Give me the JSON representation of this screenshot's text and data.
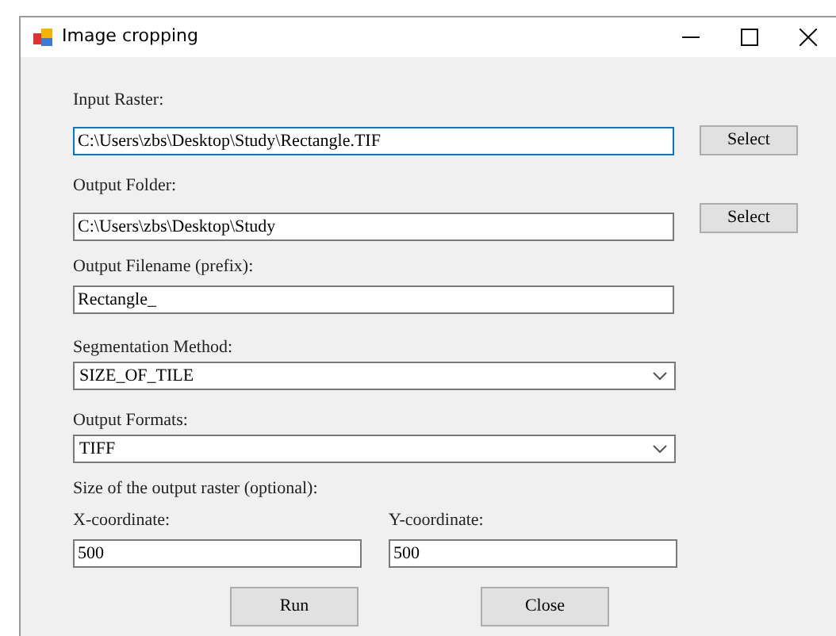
{
  "window": {
    "title": "Image cropping"
  },
  "input_raster": {
    "label": "Input Raster:",
    "value": "C:\\Users\\zbs\\Desktop\\Study\\Rectangle.TIF",
    "focused": true,
    "button": "Select"
  },
  "output_folder": {
    "label": "Output Folder:",
    "value": "C:\\Users\\zbs\\Desktop\\Study",
    "focused": false,
    "button": "Select"
  },
  "output_filename": {
    "label": "Output Filename (prefix):",
    "value": "Rectangle_"
  },
  "segmentation_method": {
    "label": "Segmentation Method:",
    "value": "SIZE_OF_TILE"
  },
  "output_formats": {
    "label": "Output Formats:",
    "value": "TIFF"
  },
  "size": {
    "label": "Size of the output raster (optional):",
    "x": {
      "label": "X-coordinate:",
      "value": "500"
    },
    "y": {
      "label": "Y-coordinate:",
      "value": "500"
    }
  },
  "buttons": [
    "Run",
    "Close"
  ]
}
